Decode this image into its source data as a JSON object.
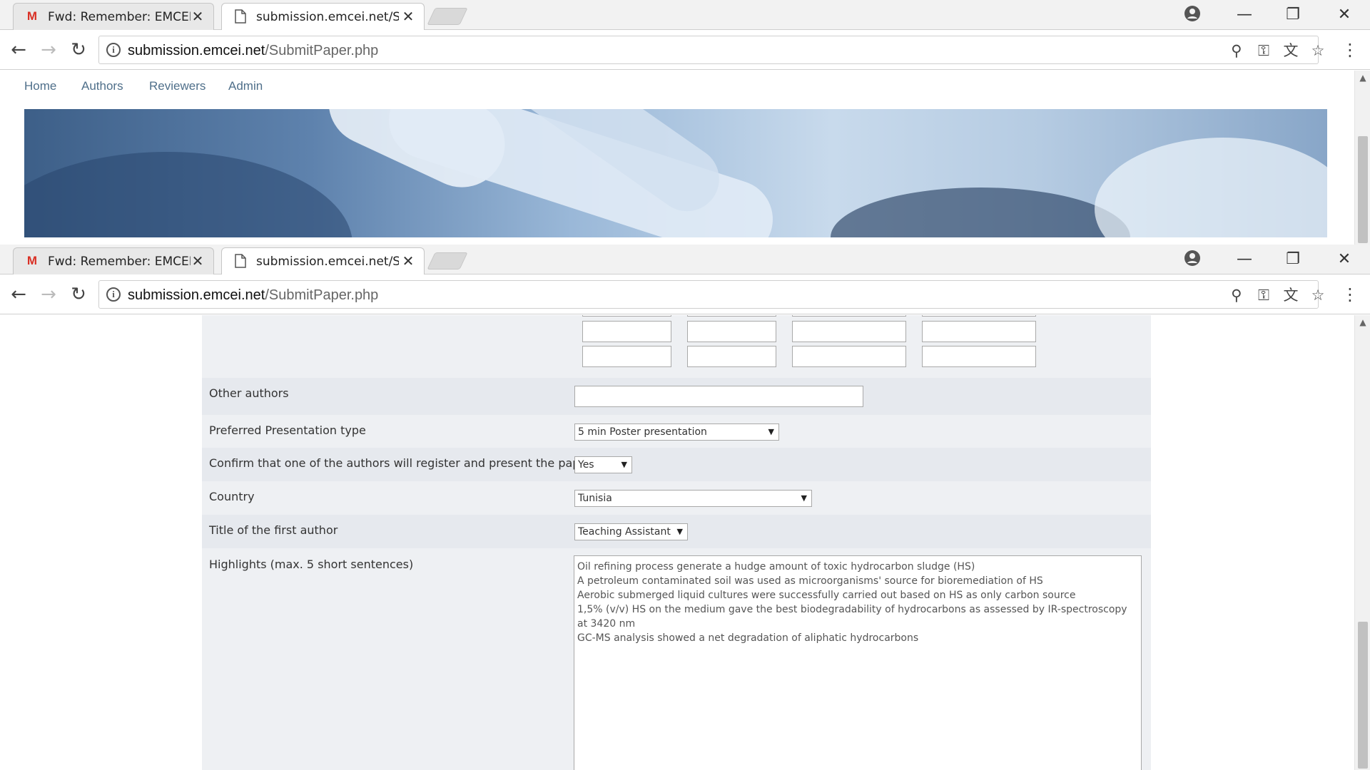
{
  "browser": {
    "tabs": [
      {
        "title": "Fwd: Remember: EMCEI-",
        "icon": "gmail-icon",
        "active": false
      },
      {
        "title": "submission.emcei.net/Su",
        "icon": "page-icon",
        "active": true
      }
    ],
    "close_glyph": "✕",
    "url_host": "submission.emcei.net",
    "url_path": "/SubmitPaper.php",
    "info_glyph": "i",
    "window_controls": {
      "minimize": "—",
      "restore": "❐",
      "close": "✕"
    },
    "toolbar_glyphs": {
      "back": "←",
      "forward": "→",
      "reload": "↻",
      "zoom": "⚲",
      "key": "⚿",
      "translate": "文",
      "star": "☆",
      "menu": "⋮"
    }
  },
  "site_nav": [
    "Home",
    "Authors",
    "Reviewers",
    "Admin"
  ],
  "form": {
    "other_authors_label": "Other authors",
    "other_authors_value": "",
    "presentation_label": "Preferred Presentation type",
    "presentation_value": "5 min Poster presentation",
    "confirm_label": "Confirm that one of the authors will register and present the paper",
    "confirm_value": "Yes",
    "country_label": "Country",
    "country_value": "Tunisia",
    "title_label": "Title of the first author",
    "title_value": "Teaching Assistant",
    "highlights_label": "Highlights (max. 5 short sentences)",
    "highlights_lines": [
      "Oil refining process generate a hudge amount of toxic hydrocarbon sludge (HS)",
      "A petroleum contaminated soil was used as microorganisms' source for bioremediation of HS",
      "Aerobic submerged liquid cultures were successfully carried out based on HS as only carbon source",
      "1,5% (v/v) HS on the medium gave the best biodegradability of hydrocarbons as assessed by IR-spectroscopy at 3420 nm",
      "GC-MS analysis showed a net degradation of aliphatic hydrocarbons"
    ]
  },
  "colors": {
    "nav_link": "#4f6f8a",
    "panel_bg": "#eef0f3",
    "gmail_red": "#d93025"
  }
}
